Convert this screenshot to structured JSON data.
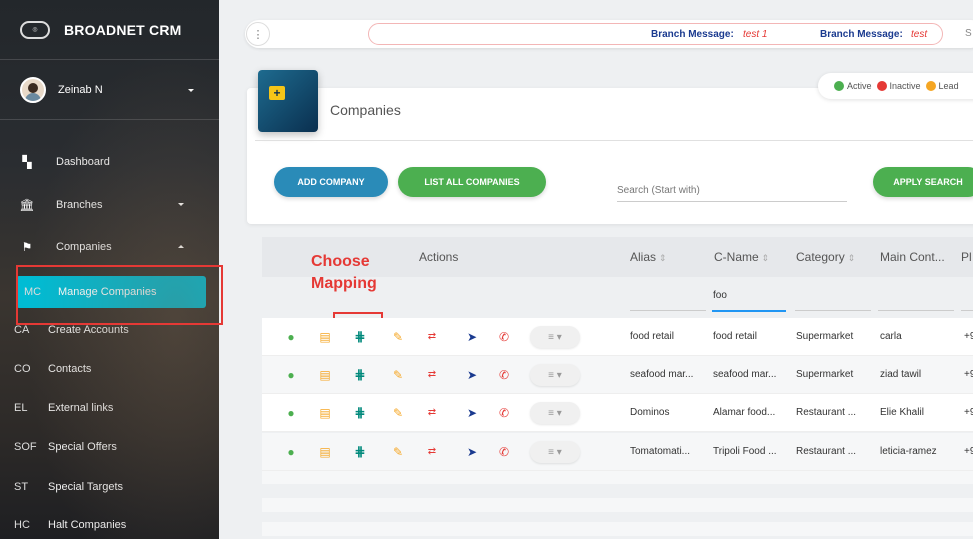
{
  "brand": {
    "name": "BROADNET CRM",
    "logo_icon": "broadnet-logo-icon"
  },
  "user": {
    "name": "Zeinab N"
  },
  "sidebar": {
    "items": [
      {
        "abbr": "",
        "label": "Dashboard",
        "icon": "dashboard-icon"
      },
      {
        "abbr": "",
        "label": "Branches",
        "icon": "bank-icon"
      },
      {
        "abbr": "",
        "label": "Companies",
        "icon": "companies-icon"
      },
      {
        "abbr": "MC",
        "label": "Manage Companies"
      },
      {
        "abbr": "CA",
        "label": "Create Accounts"
      },
      {
        "abbr": "CO",
        "label": "Contacts"
      },
      {
        "abbr": "EL",
        "label": "External links"
      },
      {
        "abbr": "SOF",
        "label": "Special Offers"
      },
      {
        "abbr": "ST",
        "label": "Special Targets"
      },
      {
        "abbr": "HC",
        "label": "Halt Companies"
      }
    ]
  },
  "topbar": {
    "messages": [
      {
        "label": "Branch Message:",
        "text": "test 1"
      },
      {
        "label": "Branch Message:",
        "text": "test"
      }
    ],
    "trailing": "S"
  },
  "page": {
    "title": "Companies"
  },
  "legend": [
    {
      "label": "Active",
      "color": "#4caf50"
    },
    {
      "label": "Inactive",
      "color": "#e53935"
    },
    {
      "label": "Lead",
      "color": "#f5a623"
    }
  ],
  "buttons": {
    "add": "ADD COMPANY",
    "list": "LIST ALL COMPANIES",
    "apply": "APPLY SEARCH"
  },
  "search": {
    "placeholder": "Search (Start with)"
  },
  "annotation": {
    "line1": "Choose",
    "line2": "Mapping"
  },
  "table": {
    "headers": {
      "actions": "Actions",
      "alias": "Alias",
      "cname": "C-Name",
      "category": "Category",
      "main_contact": "Main Cont...",
      "ph": "Pl"
    },
    "filter_cname": "foo",
    "rows": [
      {
        "alias": "food retail",
        "cname": "food retail",
        "category": "Supermarket",
        "contact": "carla",
        "phone": "+9"
      },
      {
        "alias": "seafood mar...",
        "cname": "seafood mar...",
        "category": "Supermarket",
        "contact": "ziad tawil",
        "phone": "+9"
      },
      {
        "alias": "Dominos",
        "cname": "Alamar food...",
        "category": "Restaurant ...",
        "contact": "Elie Khalil",
        "phone": "+9"
      },
      {
        "alias": "Tomatomati...",
        "cname": "Tripoli Food ...",
        "category": "Restaurant ...",
        "contact": "leticia-ramez",
        "phone": "+9"
      }
    ]
  }
}
